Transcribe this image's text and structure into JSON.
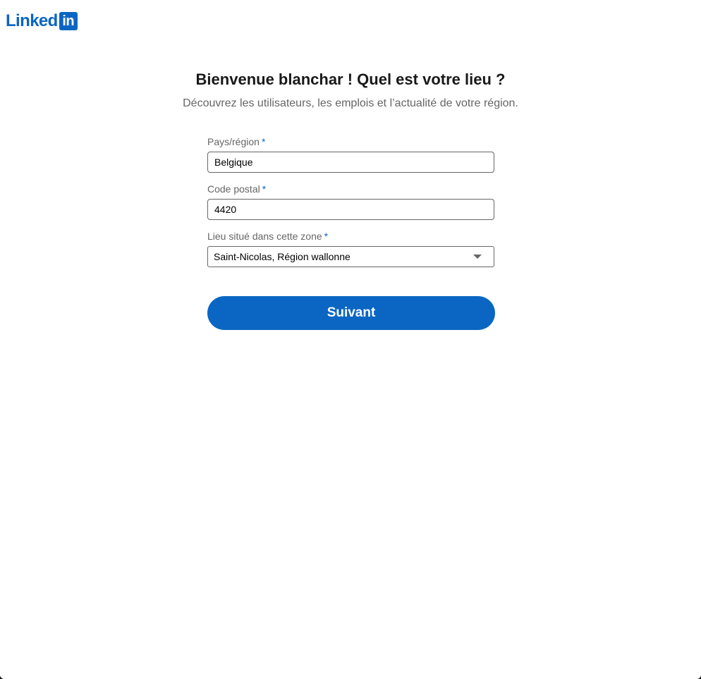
{
  "brand": {
    "wordmark": "Linked",
    "badge": "in",
    "color": "#0a66c2"
  },
  "heading": "Bienvenue blanchar ! Quel est votre lieu ?",
  "subheading": "Découvrez les utilisateurs, les emplois et l’actualité de votre région.",
  "form": {
    "required_marker": "*",
    "country": {
      "label": "Pays/région",
      "value": "Belgique"
    },
    "postal_code": {
      "label": "Code postal",
      "value": "4420"
    },
    "location": {
      "label": "Lieu situé dans cette zone",
      "selected": "Saint-Nicolas, Région wallonne",
      "icon": "chevron-down-icon"
    },
    "submit_label": "Suivant"
  }
}
